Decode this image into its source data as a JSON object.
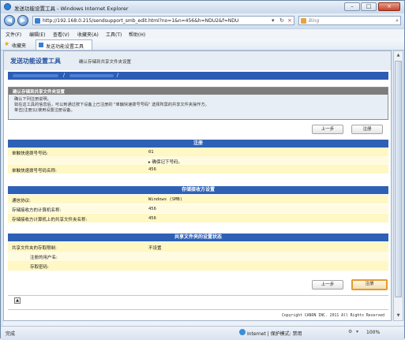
{
  "window": {
    "title": "发送功能设置工具 - Windows Internet Explorer",
    "minimize": "–",
    "maximize": "□",
    "close": "×"
  },
  "address": {
    "url": "http://192.168.0.215/sendsupport_smb_edit.html?no=1&n=456&h=NDU2&f=NDU",
    "search_placeholder": "Bing"
  },
  "menu": [
    "文件(F)",
    "编辑(E)",
    "查看(V)",
    "收藏夹(A)",
    "工具(T)",
    "帮助(H)"
  ],
  "favorites": {
    "label": "收藏夹",
    "tab_label": "发送功能设置工具"
  },
  "page": {
    "title": "发送功能设置工具",
    "subtitle": "确认存储到共享文件夹设置",
    "breadcrumb_sep": "/"
  },
  "panel": {
    "title": "确认存储到共享文件夹设置",
    "lines": [
      "确认下列注册说明。",
      "如在这工具的信息后，可以到通过按下设备上已注册的 \"单触快速拨号号码\" 选择所需的共享文件夹操作方。",
      "单击[注册]以使用设置注册设备。"
    ]
  },
  "buttons": {
    "back": "上一步",
    "register": "注册"
  },
  "sections": {
    "register": {
      "heading": "注册",
      "rows": [
        {
          "label": "单触快速拨号号码:",
          "value": "01"
        },
        {
          "label": "",
          "value": "▸ 确保记下号码。"
        },
        {
          "label": "单触快速拨号号码名称:",
          "value": "456"
        }
      ]
    },
    "destination": {
      "heading": "存储接收方设置",
      "rows": [
        {
          "label": "通信协议:",
          "value": "Windows (SMB)"
        },
        {
          "label": "存储接收方的计算机名称:",
          "value": "456"
        },
        {
          "label": "存储接收方计算机上的共享文件夹名称:",
          "value": "456"
        }
      ]
    },
    "shared": {
      "heading": "共享文件夹的设置状态",
      "rows": [
        {
          "label": "共享文件夹的存取限制:",
          "value": "不设置"
        },
        {
          "label": "注册的用户名:",
          "value": ""
        },
        {
          "label": "存取密码:",
          "value": ""
        }
      ]
    }
  },
  "copyright": "Copyright CANON INC. 2011 All Rights Reserved",
  "status": {
    "left": "完成",
    "zone": "Internet | 保护模式: 禁用",
    "zoom": "100%"
  }
}
